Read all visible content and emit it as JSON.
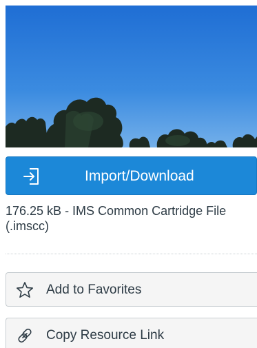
{
  "preview": {
    "alt": "Blue sky over treetops"
  },
  "actions": {
    "import_label": "Import/Download",
    "import_icon": "import-icon",
    "favorite_label": "Add to Favorites",
    "favorite_icon": "star-icon",
    "link_label": "Copy Resource Link",
    "link_icon": "link-icon"
  },
  "file": {
    "info": "176.25 kB - IMS Common Cartridge File (.imscc)"
  },
  "colors": {
    "primary": "#1c88d8",
    "text": "#2d3b45",
    "secondary_bg": "#f5f5f5",
    "border": "#c7cdd1"
  }
}
